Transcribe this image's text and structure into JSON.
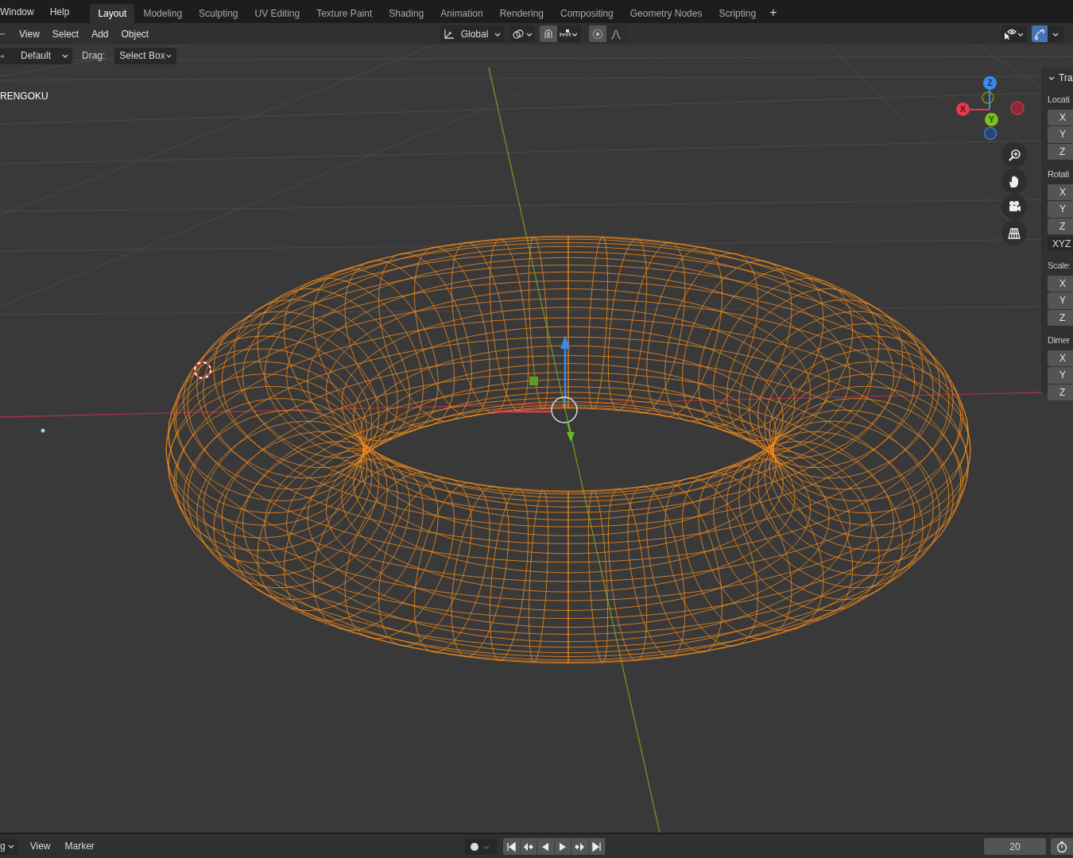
{
  "menu_bar": {
    "menus": [
      "Window",
      "Help"
    ],
    "workspace_tabs": [
      {
        "label": "Layout",
        "selected": true
      },
      {
        "label": "Modeling",
        "selected": false
      },
      {
        "label": "Sculpting",
        "selected": false
      },
      {
        "label": "UV Editing",
        "selected": false
      },
      {
        "label": "Texture Paint",
        "selected": false
      },
      {
        "label": "Shading",
        "selected": false
      },
      {
        "label": "Animation",
        "selected": false
      },
      {
        "label": "Rendering",
        "selected": false
      },
      {
        "label": "Compositing",
        "selected": false
      },
      {
        "label": "Geometry Nodes",
        "selected": false
      },
      {
        "label": "Scripting",
        "selected": false
      }
    ],
    "add_tab": "+"
  },
  "header": {
    "menus": [
      "View",
      "Select",
      "Add",
      "Object"
    ],
    "transform_orientation": "Global",
    "gizmo_toggle": {
      "on": true
    }
  },
  "tool_settings": {
    "orientation": "Default",
    "drag_label": "Drag:",
    "drag_value": "Select Box"
  },
  "viewport": {
    "object_name": "RENGOKU",
    "nav_gizmo": {
      "z": "Z",
      "y": "Y",
      "x": "X"
    }
  },
  "sidebar": {
    "panel_title": "Tra",
    "sections": [
      {
        "label": "Locati",
        "fields": [
          "X",
          "Y",
          "Z"
        ]
      },
      {
        "label": "Rotati",
        "fields": [
          "X",
          "Y",
          "Z"
        ],
        "mode": "XYZ"
      },
      {
        "label": "Scale:",
        "fields": [
          "X",
          "Y",
          "Z"
        ]
      },
      {
        "label": "Dimer",
        "fields": [
          "X",
          "Y",
          "Z"
        ]
      }
    ]
  },
  "timeline": {
    "mode": "g",
    "auto_keying": {
      "on": false
    },
    "menus": [
      "View",
      "Marker"
    ],
    "current_frame": "20"
  }
}
